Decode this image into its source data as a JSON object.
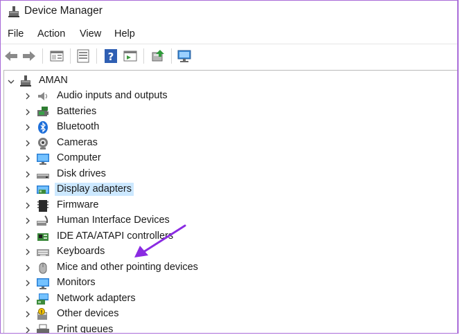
{
  "window": {
    "title": "Device Manager"
  },
  "menu": [
    "File",
    "Action",
    "View",
    "Help"
  ],
  "toolbar": {
    "buttons": [
      "back-icon",
      "forward-icon",
      "properties-window-icon",
      "device-list-icon",
      "help-icon",
      "show-hidden-icon",
      "update-driver-icon",
      "scan-hardware-icon"
    ]
  },
  "tree": {
    "root": "AMAN",
    "items": [
      {
        "label": "Audio inputs and outputs",
        "icon": "speaker-icon"
      },
      {
        "label": "Batteries",
        "icon": "battery-icon"
      },
      {
        "label": "Bluetooth",
        "icon": "bluetooth-icon"
      },
      {
        "label": "Cameras",
        "icon": "camera-icon"
      },
      {
        "label": "Computer",
        "icon": "computer-icon"
      },
      {
        "label": "Disk drives",
        "icon": "disk-drive-icon"
      },
      {
        "label": "Display adapters",
        "icon": "display-adapter-icon",
        "selected": true
      },
      {
        "label": "Firmware",
        "icon": "firmware-chip-icon"
      },
      {
        "label": "Human Interface Devices",
        "icon": "hid-icon"
      },
      {
        "label": "IDE ATA/ATAPI controllers",
        "icon": "ide-controller-icon"
      },
      {
        "label": "Keyboards",
        "icon": "keyboard-icon"
      },
      {
        "label": "Mice and other pointing devices",
        "icon": "mouse-icon"
      },
      {
        "label": "Monitors",
        "icon": "monitor-icon"
      },
      {
        "label": "Network adapters",
        "icon": "network-adapter-icon"
      },
      {
        "label": "Other devices",
        "icon": "other-devices-icon"
      },
      {
        "label": "Print queues",
        "icon": "printer-icon"
      }
    ]
  },
  "colors": {
    "accent": "#8a2be2",
    "selection": "#cce8ff",
    "frame": "#a86ad8"
  }
}
